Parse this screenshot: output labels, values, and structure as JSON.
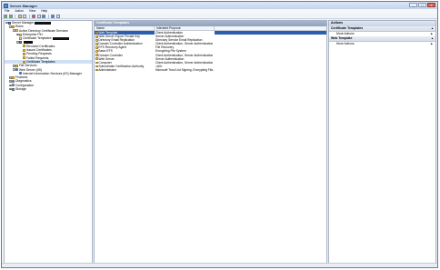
{
  "window": {
    "title": "Server Manager"
  },
  "menu": [
    "File",
    "Action",
    "View",
    "Help"
  ],
  "tree": [
    {
      "label": "Server Manager",
      "level": 0,
      "icon": "server-icon",
      "expander": "-",
      "redacted": true
    },
    {
      "label": "Roles",
      "level": 1,
      "icon": "folder-icon",
      "expander": "-"
    },
    {
      "label": "Active Directory Certificate Services",
      "level": 2,
      "icon": "cert-icon",
      "expander": "-"
    },
    {
      "label": "Enterprise PKI",
      "level": 3,
      "icon": "cert-icon",
      "expander": "+"
    },
    {
      "label": "Certificate Templates",
      "level": 3,
      "icon": "cert-icon",
      "expander": "",
      "redacted": true
    },
    {
      "label": "",
      "level": 3,
      "icon": "server-icon",
      "expander": "-",
      "redacted": true
    },
    {
      "label": "Revoked Certificates",
      "level": 4,
      "icon": "folder-icon",
      "expander": ""
    },
    {
      "label": "Issued Certificates",
      "level": 4,
      "icon": "folder-icon",
      "expander": ""
    },
    {
      "label": "Pending Requests",
      "level": 4,
      "icon": "folder-icon",
      "expander": ""
    },
    {
      "label": "Failed Requests",
      "level": 4,
      "icon": "folder-icon",
      "expander": ""
    },
    {
      "label": "Certificate Templates",
      "level": 4,
      "icon": "folder-icon",
      "expander": "",
      "selected": true
    },
    {
      "label": "File Services",
      "level": 2,
      "icon": "folder-icon",
      "expander": "+"
    },
    {
      "label": "Web Server (IIS)",
      "level": 2,
      "icon": "globe-icon",
      "expander": "-"
    },
    {
      "label": "Internet Information Services (IIS) Manager",
      "level": 3,
      "icon": "globe-icon",
      "expander": ""
    },
    {
      "label": "Features",
      "level": 1,
      "icon": "folder-icon",
      "expander": "+"
    },
    {
      "label": "Diagnostics",
      "level": 1,
      "icon": "gear-icon",
      "expander": "+"
    },
    {
      "label": "Configuration",
      "level": 1,
      "icon": "gear-icon",
      "expander": "+"
    },
    {
      "label": "Storage",
      "level": 1,
      "icon": "disk-icon",
      "expander": "+"
    }
  ],
  "center": {
    "title": "Certificate Templates",
    "columns": [
      "Name",
      "Intended Purpose"
    ],
    "rows": [
      {
        "name": "Web Template",
        "purpose": "Client Authentication",
        "selected": true
      },
      {
        "name": "Web Server Export Private Key",
        "purpose": "Server Authentication"
      },
      {
        "name": "Directory Email Replication",
        "purpose": "Directory Service Email Replication"
      },
      {
        "name": "Domain Controller Authentication",
        "purpose": "Client Authentication, Server Authentication"
      },
      {
        "name": "EFS Recovery Agent",
        "purpose": "File Recovery"
      },
      {
        "name": "Basic EFS",
        "purpose": "Encrypting File System"
      },
      {
        "name": "Domain Controller",
        "purpose": "Client Authentication, Server Authentication"
      },
      {
        "name": "Web Server",
        "purpose": "Server Authentication"
      },
      {
        "name": "Computer",
        "purpose": "Client Authentication, Server Authentication"
      },
      {
        "name": "Subordinate Certification Authority",
        "purpose": "<All>"
      },
      {
        "name": "Administrator",
        "purpose": "Microsoft Trust List Signing, Encrypting File..."
      }
    ]
  },
  "actions": {
    "title": "Actions",
    "sections": [
      {
        "header": "Certificate Templates",
        "items": [
          "More Actions"
        ]
      },
      {
        "header": "Web Template",
        "items": [
          "More Actions"
        ]
      }
    ]
  }
}
